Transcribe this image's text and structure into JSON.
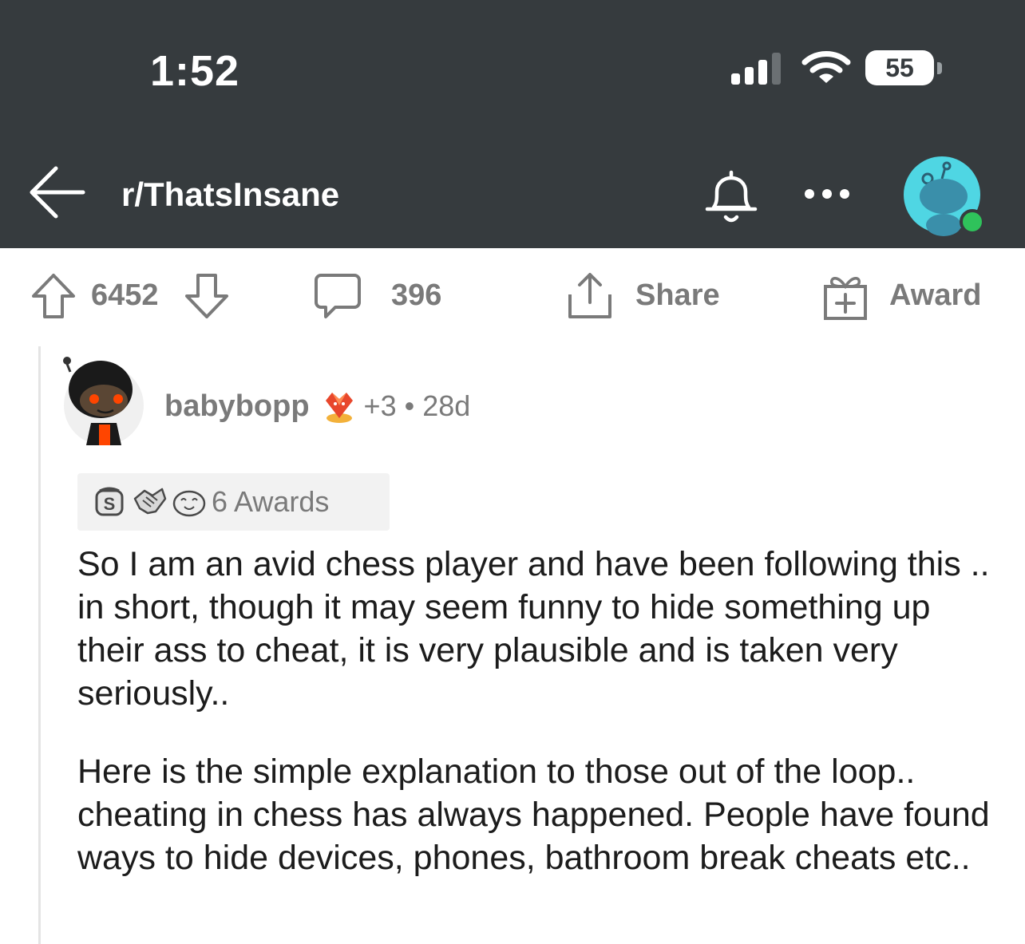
{
  "status_bar": {
    "time": "1:52",
    "battery": "55"
  },
  "header": {
    "subreddit": "r/ThatsInsane",
    "icons": [
      "back-arrow-icon",
      "bell-icon",
      "more-icon",
      "avatar"
    ]
  },
  "actions": {
    "vote_count": "6452",
    "comment_count": "396",
    "share_label": "Share",
    "award_label": "Award"
  },
  "comment": {
    "author": "babybopp",
    "flair_count": "+3",
    "separator": "•",
    "age": "28d",
    "awards_text": "6 Awards",
    "paragraphs": [
      "So I am an avid chess player and have been following this .. in short, though it may seem funny to hide something up their ass to cheat, it is very plausible and is taken very seriously..",
      "Here is the simple explanation to those out of the loop.. cheating in chess has always happened. People have found ways to hide devices, phones, bathroom break cheats etc.."
    ]
  },
  "colors": {
    "header_bg": "#363b3e",
    "muted_text": "#7a7a7a",
    "avatar_teal": "#4fd6e3",
    "online_green": "#2fc25b",
    "accent_orange": "#ff4500"
  }
}
